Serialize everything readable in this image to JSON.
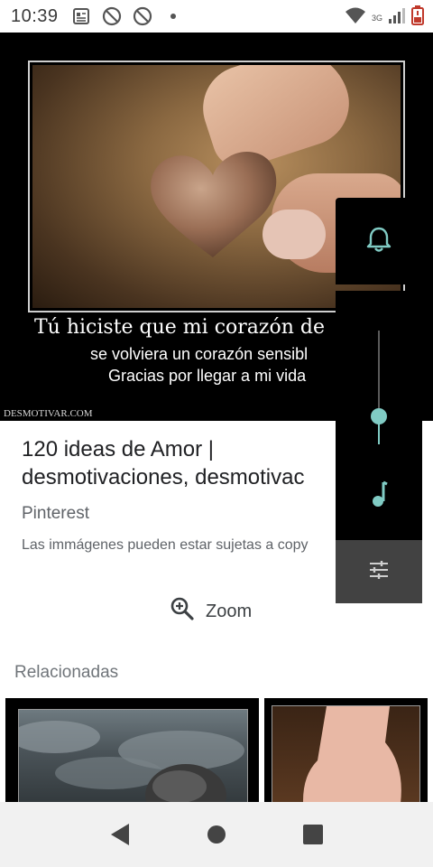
{
  "status_bar": {
    "time": "10:39",
    "icons": [
      "news-icon",
      "blocked-icon",
      "blocked-icon",
      "dot-icon"
    ],
    "network": "3G",
    "right_icons": [
      "wifi-icon",
      "signal-icon",
      "battery-icon"
    ]
  },
  "hero": {
    "caption_main": "Tú hiciste que mi corazón de",
    "caption_line2": "se volviera un corazón sensibl",
    "caption_line3": "Gracias por llegar a mi vida",
    "watermark": "DESMOTIVAR.COM"
  },
  "result": {
    "title_line1": "120 ideas de Amor |",
    "title_line2": "desmotivaciones, desmotivac",
    "source": "Pinterest",
    "disclaimer": "Las immágenes pueden estar sujetas a copy",
    "zoom_label": "Zoom"
  },
  "related": {
    "label": "Relacionadas"
  },
  "volume_panel": {
    "level": 0.25,
    "accent": "#80cbc4",
    "icons": [
      "bell-icon",
      "music-note-icon",
      "equalizer-settings-icon"
    ]
  },
  "nav_bar": {
    "buttons": [
      "back-icon",
      "home-icon",
      "recents-icon"
    ]
  }
}
